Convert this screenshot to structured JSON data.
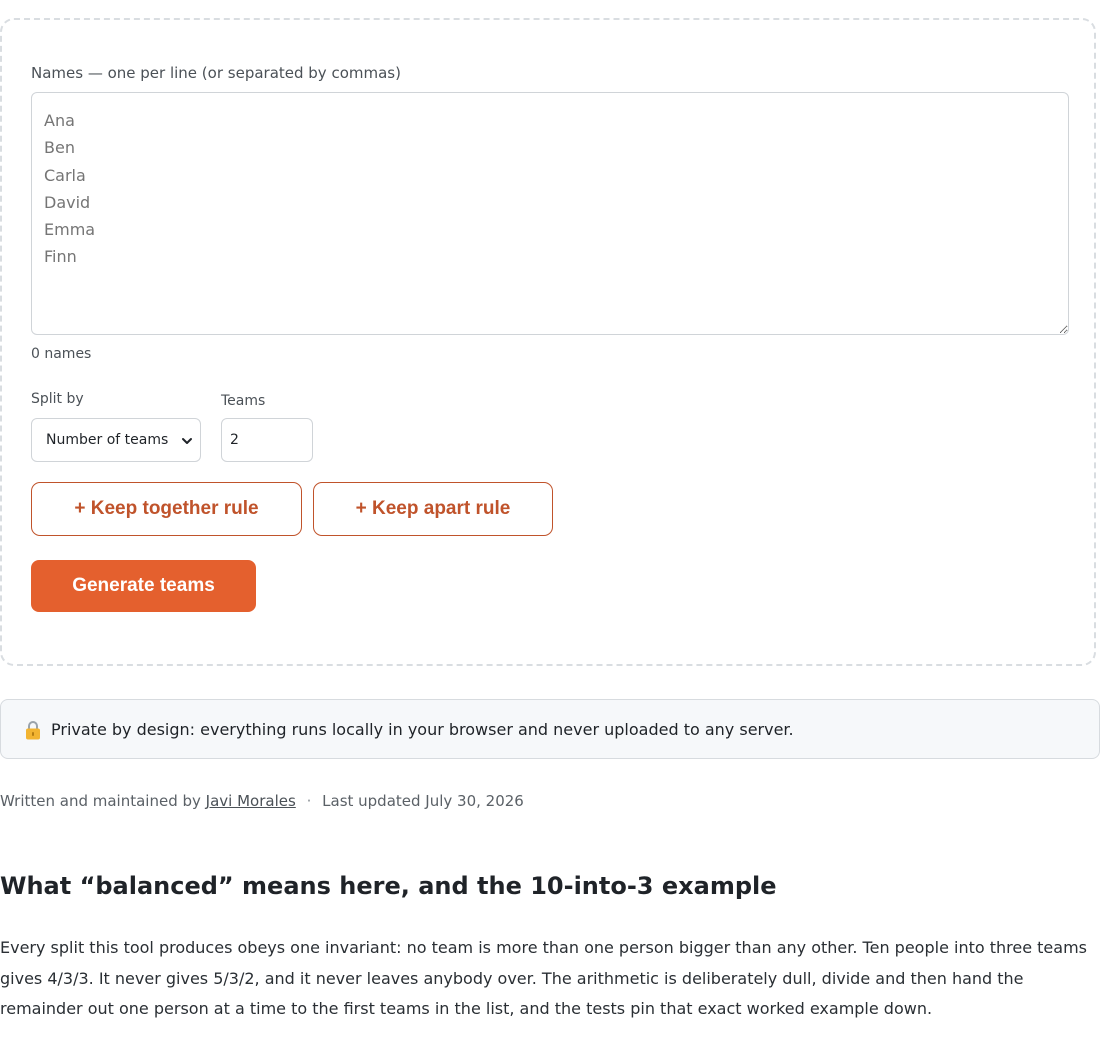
{
  "form": {
    "names_label": "Names — one per line (or separated by commas)",
    "names_placeholder": "Ana\nBen\nCarla\nDavid\nEmma\nFinn",
    "names_count": "0 names",
    "split_label": "Split by",
    "split_value": "Number of teams",
    "teams_label": "Teams",
    "teams_value": "2",
    "keep_together_label": "+ Keep together rule",
    "keep_apart_label": "+ Keep apart rule",
    "generate_label": "Generate teams"
  },
  "privacy": {
    "icon": "lock-icon",
    "text": "Private by design: everything runs locally in your browser and never uploaded to any server."
  },
  "byline": {
    "prefix": "Written and maintained by",
    "author": "Javi Morales",
    "separator": "·",
    "updated": "Last updated July 30, 2026"
  },
  "article": {
    "heading": "What “balanced” means here, and the 10-into-3 example",
    "paragraph": "Every split this tool produces obeys one invariant: no team is more than one person bigger than any other. Ten people into three teams gives 4/3/3. It never gives 5/3/2, and it never leaves anybody over. The arithmetic is deliberately dull, divide and then hand the remainder out one person at a time to the first teams in the list, and the tests pin that exact worked example down."
  },
  "colors": {
    "accent": "#e4602e",
    "accent_text": "#c0532b",
    "border": "#d0d4d8",
    "privacy_bg": "#f6f8fa"
  }
}
